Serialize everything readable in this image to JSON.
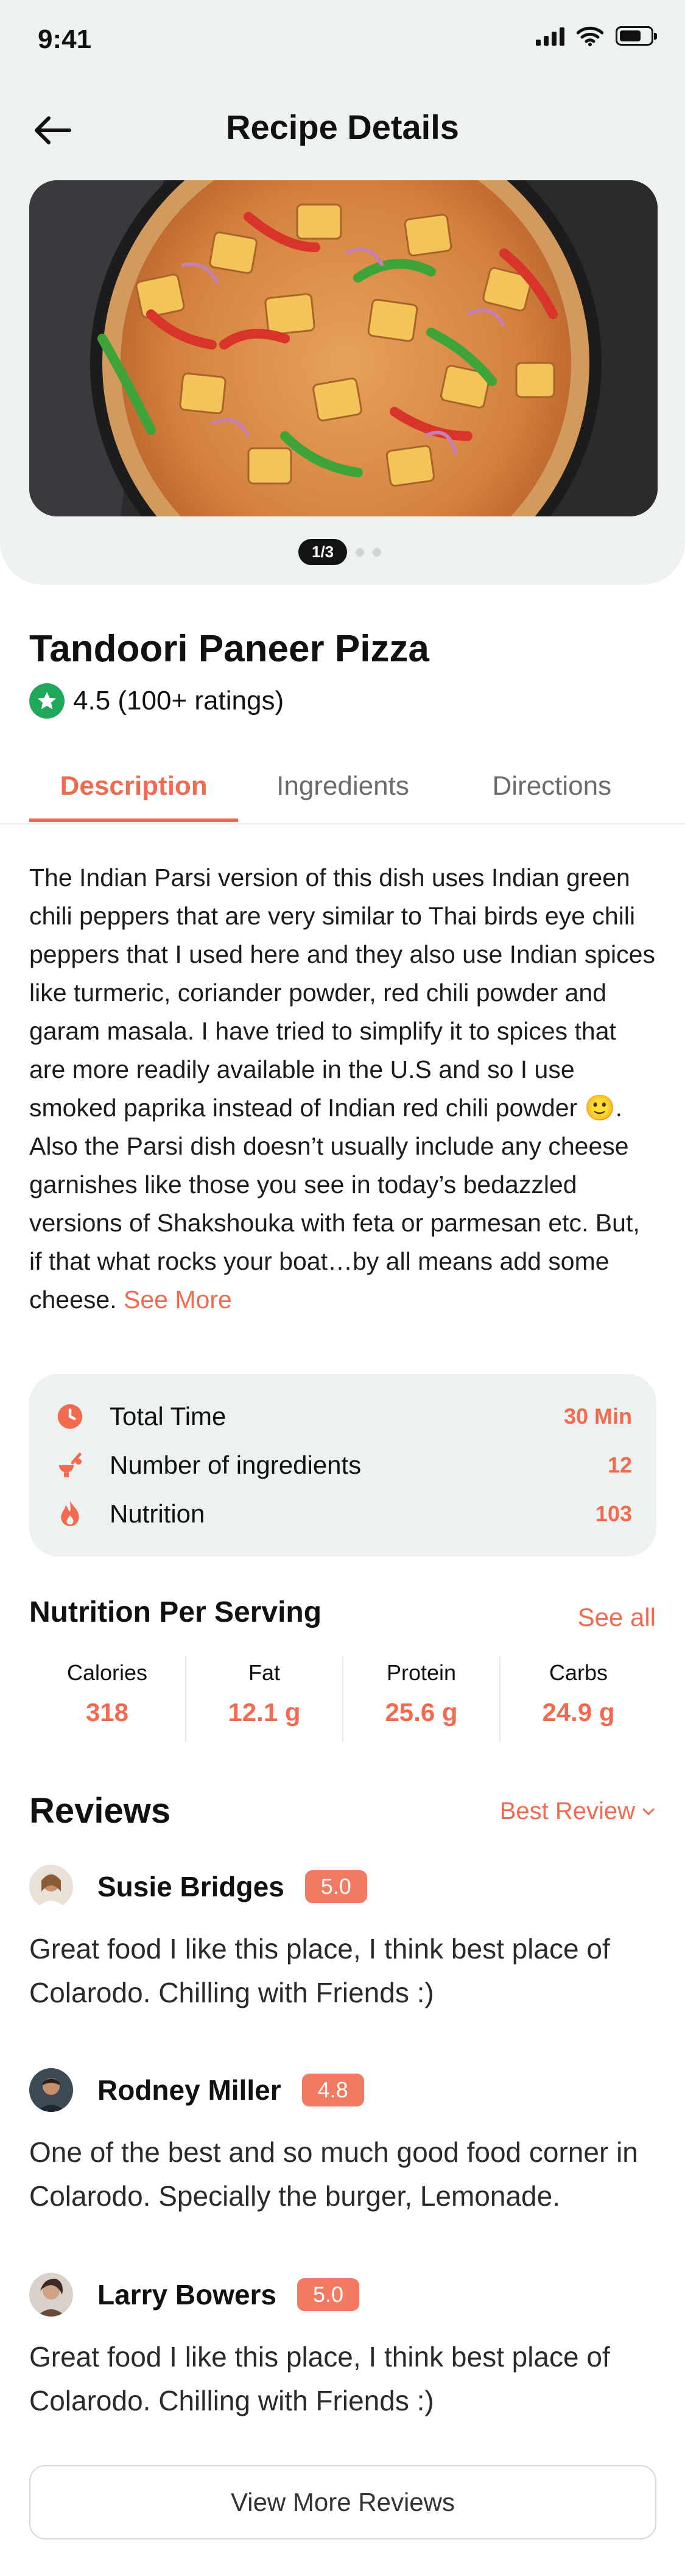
{
  "status_bar": {
    "time": "9:41"
  },
  "header": {
    "title": "Recipe Details"
  },
  "gallery": {
    "counter": "1/3"
  },
  "recipe": {
    "title": "Tandoori Paneer Pizza",
    "rating": "4.5 (100+ ratings)"
  },
  "tabs": [
    "Description",
    "Ingredients",
    "Directions"
  ],
  "description": {
    "text": "The Indian Parsi version of this dish uses Indian green chili peppers that are very similar to Thai birds eye chili peppers that I used here and they also use Indian spices like turmeric, coriander powder, red chili powder and garam masala. I have tried to simplify it to spices that are more readily available in the U.S and so I use smoked paprika instead of Indian red chili powder 🙂.  Also the Parsi dish doesn’t usually include any cheese garnishes like those you see in today’s bedazzled versions of Shakshouka with feta or parmesan etc. But, if that what rocks your boat…by all means add some cheese.",
    "see_more": "See More"
  },
  "info": {
    "total_time": {
      "label": "Total Time",
      "value": "30 Min",
      "icon": "clock-icon"
    },
    "ingredients": {
      "label": "Number of ingredients",
      "value": "12",
      "icon": "ingredients-icon"
    },
    "nutrition": {
      "label": "Nutrition",
      "value": "103",
      "icon": "flame-icon"
    }
  },
  "nutrition": {
    "title": "Nutrition Per Serving",
    "see_all": "See all",
    "items": [
      {
        "label": "Calories",
        "value": "318"
      },
      {
        "label": "Fat",
        "value": "12.1 g"
      },
      {
        "label": "Protein",
        "value": "25.6 g"
      },
      {
        "label": "Carbs",
        "value": "24.9 g"
      }
    ]
  },
  "reviews": {
    "title": "Reviews",
    "sort": "Best Review",
    "items": [
      {
        "name": "Susie Bridges",
        "score": "5.0",
        "text": "Great food I like this place, I think best place of Colarodo. Chilling with Friends :)"
      },
      {
        "name": "Rodney Miller",
        "score": "4.8",
        "text": "One of the best and so much good food corner in Colarodo. Specially the burger, Lemonade."
      },
      {
        "name": "Larry Bowers",
        "score": "5.0",
        "text": "Great food I like this place, I think best place of Colarodo. Chilling with Friends :)"
      }
    ],
    "view_more": "View More Reviews"
  },
  "colors": {
    "accent": "#f26b50",
    "rating_green": "#1fa85a",
    "card_bg": "#edf2f1"
  }
}
